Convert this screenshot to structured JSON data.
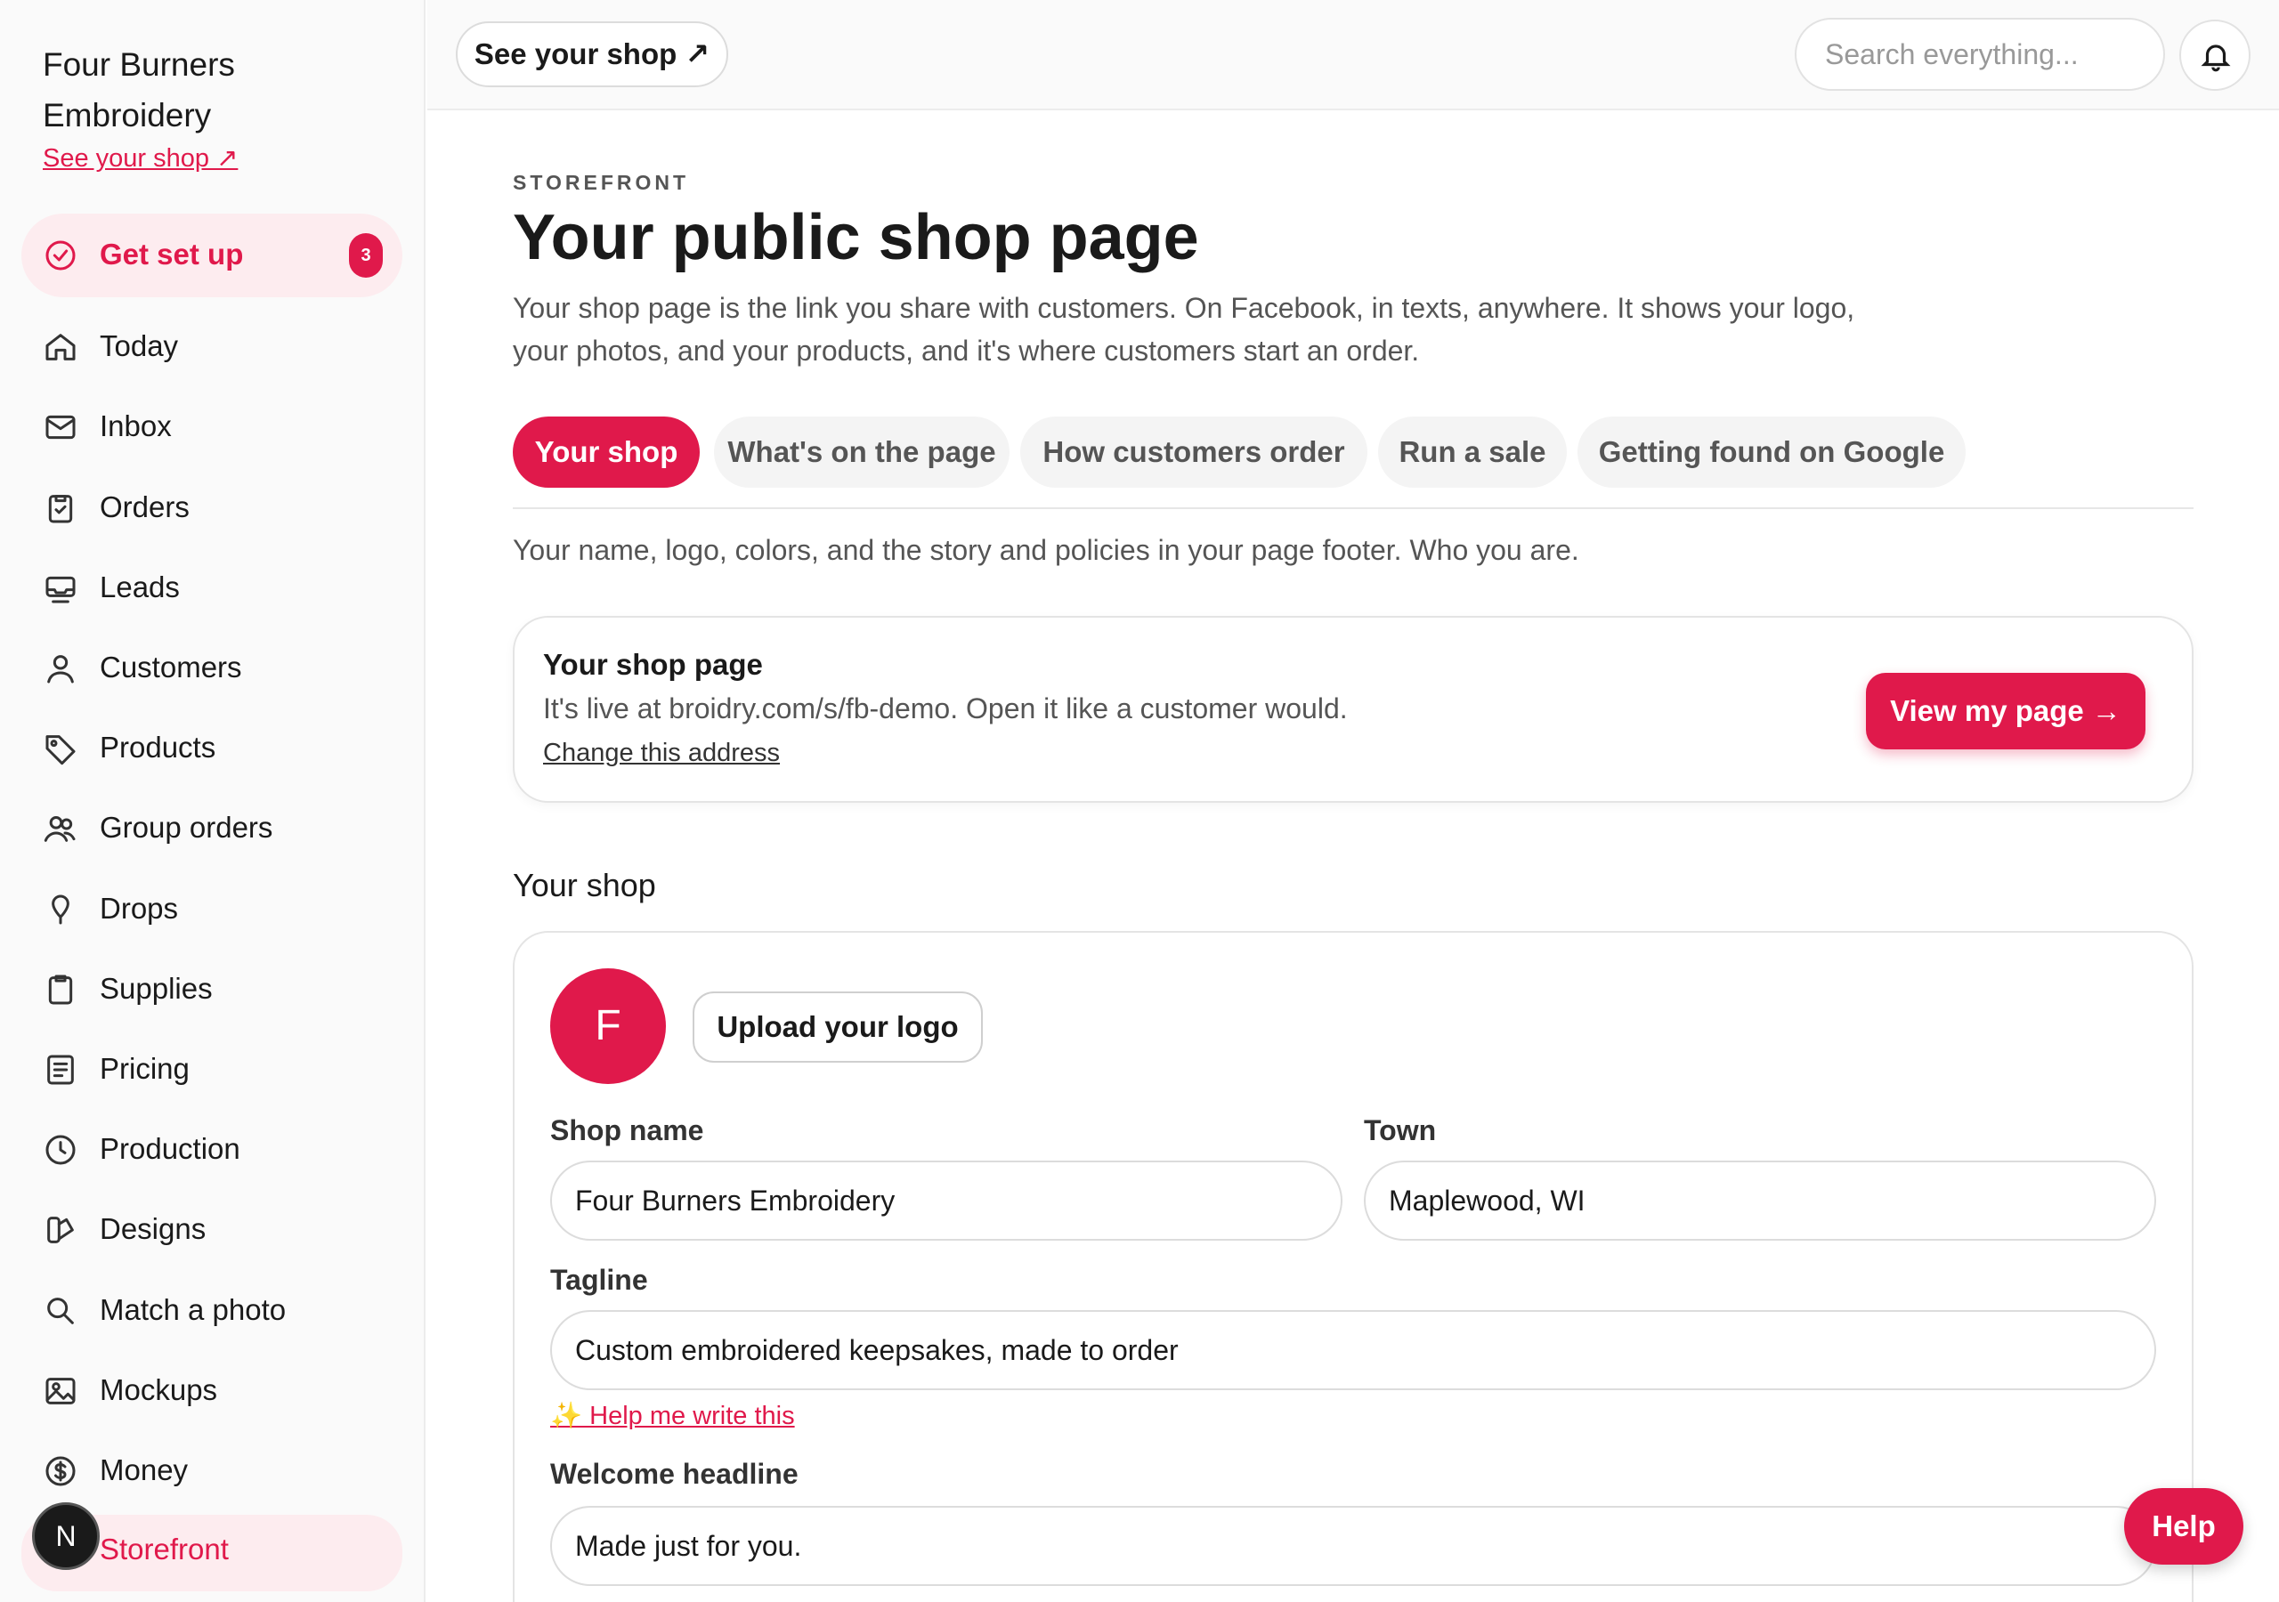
{
  "sidebar": {
    "shop_name": "Four Burners Embroidery",
    "see_shop_link": "See your shop ↗",
    "setup": {
      "label": "Get set up",
      "badge": "3"
    },
    "items": [
      {
        "label": "Today",
        "icon": "home-icon"
      },
      {
        "label": "Inbox",
        "icon": "mail-icon"
      },
      {
        "label": "Orders",
        "icon": "clipboard-check-icon"
      },
      {
        "label": "Leads",
        "icon": "inbox-tray-icon"
      },
      {
        "label": "Customers",
        "icon": "user-icon"
      },
      {
        "label": "Products",
        "icon": "tag-icon"
      },
      {
        "label": "Group orders",
        "icon": "users-icon"
      },
      {
        "label": "Drops",
        "icon": "pin-icon"
      },
      {
        "label": "Supplies",
        "icon": "clipboard-icon"
      },
      {
        "label": "Pricing",
        "icon": "list-icon"
      },
      {
        "label": "Production",
        "icon": "clock-icon"
      },
      {
        "label": "Designs",
        "icon": "palette-icon"
      },
      {
        "label": "Match a photo",
        "icon": "search-icon"
      },
      {
        "label": "Mockups",
        "icon": "image-icon"
      },
      {
        "label": "Money",
        "icon": "dollar-icon"
      },
      {
        "label": "Storefront",
        "icon": "store-icon"
      }
    ],
    "avatar_letter": "N"
  },
  "topbar": {
    "see_shop_btn": "See your shop ↗",
    "search_placeholder": "Search everything..."
  },
  "main": {
    "eyebrow": "STOREFRONT",
    "title": "Your public shop page",
    "intro": "Your shop page is the link you share with customers. On Facebook, in texts, anywhere. It shows your logo, your photos, and your products, and it's where customers start an order.",
    "tabs": [
      {
        "label": "Your shop",
        "active": true
      },
      {
        "label": "What's on the page",
        "active": false
      },
      {
        "label": "How customers order",
        "active": false
      },
      {
        "label": "Run a sale",
        "active": false
      },
      {
        "label": "Getting found on Google",
        "active": false
      }
    ],
    "tab_description": "Your name, logo, colors, and the story and policies in your page footer. Who you are.",
    "page_card": {
      "title": "Your shop page",
      "subtitle": "It's live at broidry.com/s/fb-demo. Open it like a customer would.",
      "change_link": "Change this address",
      "view_btn": "View my page →"
    },
    "section_title": "Your shop",
    "form": {
      "logo_letter": "F",
      "upload_btn": "Upload your logo",
      "shop_name_label": "Shop name",
      "shop_name_value": "Four Burners Embroidery",
      "town_label": "Town",
      "town_value": "Maplewood, WI",
      "tagline_label": "Tagline",
      "tagline_value": "Custom embroidered keepsakes, made to order",
      "help_write": "✨ Help me write this",
      "welcome_label": "Welcome headline",
      "welcome_value": "Made just for you."
    }
  },
  "help_btn": "Help",
  "colors": {
    "accent": "#e0194b",
    "accent_soft": "#fdecef"
  }
}
